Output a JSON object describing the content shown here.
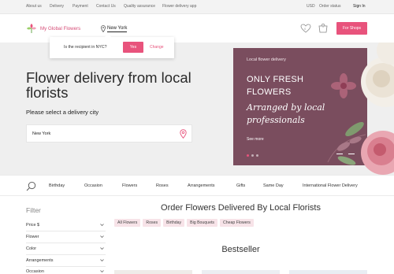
{
  "topbar": {
    "links": [
      "About us",
      "Delivery",
      "Payment",
      "Contact Us",
      "Quality assurance",
      "Flower delivery app"
    ],
    "currency": "USD",
    "order_status": "Order status",
    "sign_in": "Sign In"
  },
  "header": {
    "logo_text": "My Global Flowers",
    "location": "New York",
    "favorites_count": "0",
    "cart_count": "0",
    "shops_button": "For Shops"
  },
  "popup": {
    "question": "Is the recipient in NYC?",
    "yes": "Yes",
    "change": "Change"
  },
  "hero": {
    "title": "Flower delivery from local florists",
    "subtitle": "Please select a delivery city",
    "city_value": "New York"
  },
  "promo": {
    "small": "Local flower delivery",
    "big_line1": "ONLY FRESH",
    "big_line2": "FLOWERS",
    "italic_line1": "Arranged by local",
    "italic_line2": "professionals",
    "see_more": "See more",
    "slide_index": 1,
    "slide_count": 3
  },
  "catnav": {
    "items": [
      "Birthday",
      "Occasion",
      "Flowers",
      "Roses",
      "Arrangements",
      "Gifts",
      "Same Day",
      "International Flower Delivery"
    ]
  },
  "filter": {
    "title": "Filter",
    "items": [
      "Price $",
      "Flower",
      "Color",
      "Arrangements",
      "Occasion"
    ]
  },
  "main": {
    "title": "Order Flowers Delivered By Local Florists",
    "chips": [
      "All Flowers",
      "Roses",
      "Birthday",
      "Big Bouquets",
      "Cheap Flowers"
    ],
    "bestseller": "Bestseller"
  },
  "colors": {
    "accent": "#e8537c",
    "promo_bg": "#7a4d5e",
    "chip_bg": "#f7e3e8"
  },
  "icons": [
    "logo-flower-icon",
    "location-pin-icon",
    "heart-icon",
    "cart-icon",
    "search-icon",
    "chevron-down-icon"
  ]
}
